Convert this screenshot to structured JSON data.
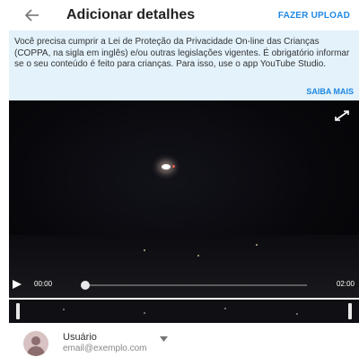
{
  "header": {
    "title": "Adicionar detalhes",
    "upload_label": "FAZER UPLOAD",
    "back_icon": "arrow-back-icon"
  },
  "banner": {
    "text": "Você precisa cumprir a Lei de Proteção da Privacidade On-line das Crianças (COPPA, na sigla em inglês) e/ou outras legislações vigentes. É obrigatório informar se o seu conteúdo é feito para crianças. Para isso, use o app YouTube Studio.",
    "learn_more_label": "SAIBA MAIS"
  },
  "player": {
    "current_time": "00:00",
    "total_time": "02:00",
    "progress": 0.0,
    "expand_icon": "expand-icon",
    "play_icon": "play-icon"
  },
  "account": {
    "name": "Usuário",
    "email": "email@exemplo.com",
    "dropdown_icon": "chevron-down-icon"
  },
  "colors": {
    "accent": "#1e88e5",
    "banner_bg": "#e3f2fb",
    "video_bg": "#070709"
  }
}
